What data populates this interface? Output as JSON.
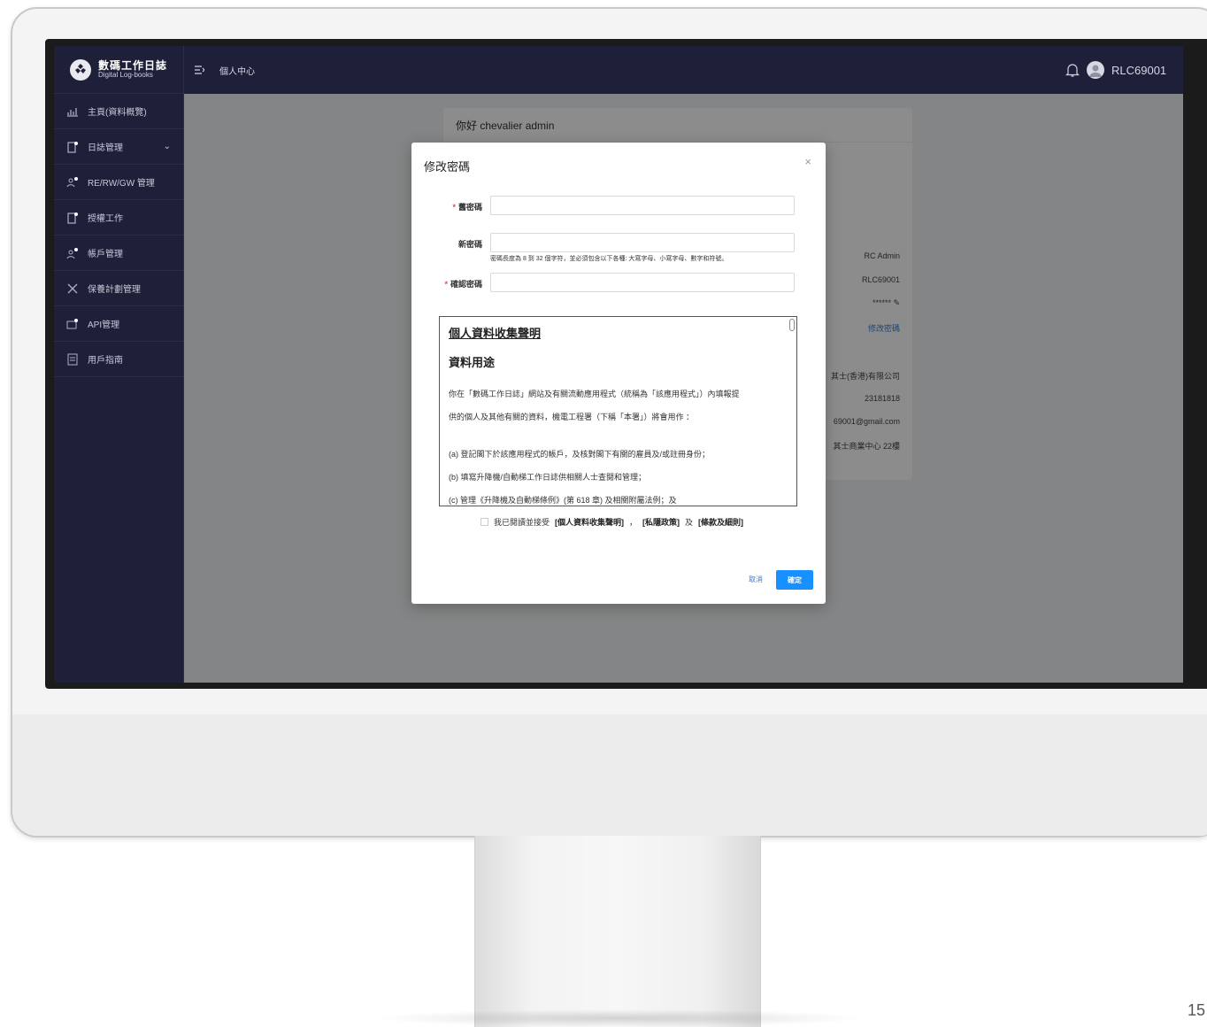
{
  "app": {
    "logo_cn": "數碼工作日誌",
    "logo_en": "Digital Log-books"
  },
  "sidebar": {
    "items": [
      {
        "label": "主頁(資料概覽)",
        "icon": "dashboard-icon"
      },
      {
        "label": "日誌管理",
        "icon": "logbook-icon",
        "arrow": "⌄"
      },
      {
        "label": "RE/RW/GW 管理",
        "icon": "team-icon"
      },
      {
        "label": "授權工作",
        "icon": "authorize-icon"
      },
      {
        "label": "帳戶管理",
        "icon": "account-icon"
      },
      {
        "label": "保養計劃管理",
        "icon": "tools-icon"
      },
      {
        "label": "API管理",
        "icon": "api-icon"
      },
      {
        "label": "用戶指南",
        "icon": "guide-icon"
      }
    ]
  },
  "header": {
    "breadcrumb": "個人中心",
    "username": "RLC69001"
  },
  "card": {
    "greeting": "你好 chevalier admin",
    "role": "RC Admin",
    "login": "RLC69001",
    "password_mask": "****** ✎",
    "change_password_link": "修改密碼",
    "company": "其士(香港)有限公司",
    "phone": "23181818",
    "email": "69001@gmail.com",
    "address": "其士商業中心 22樓"
  },
  "modal": {
    "title": "修改密碼",
    "close": "×",
    "old_password_label": "舊密碼",
    "new_password_label": "新密碼",
    "confirm_password_label": "確認密碼",
    "required_mark": "*",
    "password_hint": "密碼長度為 8 到 32 個字符，並必須包含以下各種: 大寫字母、小寫字母、數字和符號。",
    "notice": {
      "heading": "個人資料收集聲明",
      "subheading": "資料用途",
      "para1_line1": "你在「數碼工作日誌」網站及有關流動應用程式（統稱為「該應用程式」）內填報提",
      "para1_line2": "供的個人及其他有關的資料，機電工程署（下稱「本署」）將會用作 ：",
      "item_a": "(a) 登記閣下於該應用程式的帳戶，及核對閣下有關的雇員及/或註冊身份；",
      "item_b": "(b) 填寫升降機/自動梯工作日誌供相關人士查閱和管理；",
      "item_c": "(c) 管理《升降機及自動梯條例》(第 618 章) 及相關附屬法例；及"
    },
    "agree": {
      "prefix": "我已閱讀並接受",
      "pics": "[個人資料收集聲明]",
      "sep1": "，",
      "privacy": "[私隱政策]",
      "and": "及",
      "terms": "[條款及細則]"
    },
    "cancel": "取消",
    "ok": "確定"
  },
  "page_number": "15"
}
